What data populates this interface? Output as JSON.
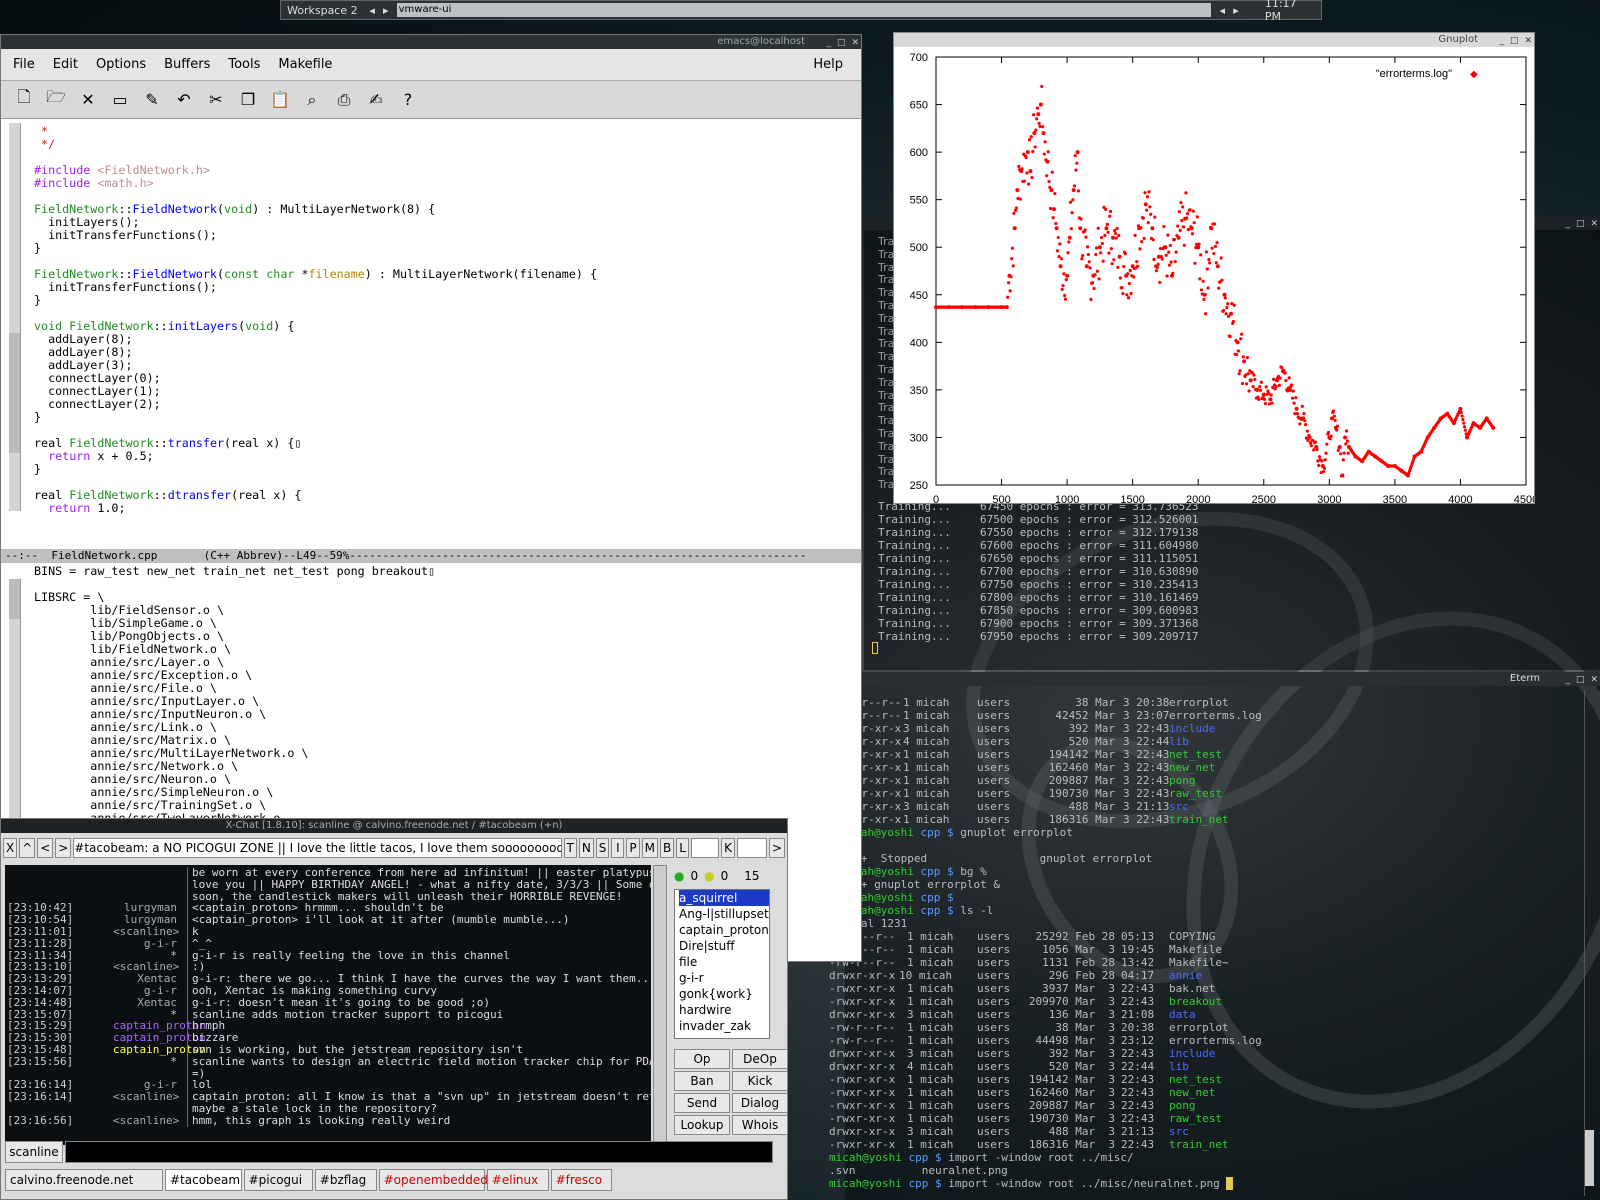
{
  "taskbar": {
    "workspace": "Workspace 2",
    "task": "vmware-ui",
    "clock": "11:17 PM"
  },
  "emacs": {
    "title": "emacs@localhost",
    "menu": [
      "File",
      "Edit",
      "Options",
      "Buffers",
      "Tools",
      "Makefile"
    ],
    "help": "Help",
    "modeline": "--:--  FieldNetwork.cpp       (C++ Abbrev)--L49--59%---------------------------------------------------------------------",
    "lower_first": "BINS = raw_test new_net train_net net_test pong breakout",
    "libsrc": [
      "LIBSRC = \\",
      "        lib/FieldSensor.o \\",
      "        lib/SimpleGame.o \\",
      "        lib/PongObjects.o \\",
      "        lib/FieldNetwork.o \\",
      "        annie/src/Layer.o \\",
      "        annie/src/Exception.o \\",
      "        annie/src/File.o \\",
      "        annie/src/InputLayer.o \\",
      "        annie/src/InputNeuron.o \\",
      "        annie/src/Link.o \\",
      "        annie/src/Matrix.o \\",
      "        annie/src/MultiLayerNetwork.o \\",
      "        annie/src/Network.o \\",
      "        annie/src/Neuron.o \\",
      "        annie/src/SimpleNeuron.o \\",
      "        annie/src/TrainingSet.o \\",
      "        annie/src/TwoLayerNetwork.o"
    ]
  },
  "xchat": {
    "title": "X-Chat [1.8.10]: scanline @ calvino.freenode.net / #tacobeam (+n)",
    "topic": "#tacobeam: a NO PICOGUI ZONE || I love the little tacos, I love them soooooooooo goo",
    "modebtns": [
      "T",
      "N",
      "S",
      "I",
      "P",
      "M",
      "B",
      "L",
      "K"
    ],
    "counts": [
      "0",
      "0",
      "15"
    ],
    "lines": [
      {
        "t": "",
        "n": "",
        "m": "be worn at every conference from here ad infinitum! || easter platypus, we"
      },
      {
        "t": "",
        "n": "",
        "m": "love you || HAPPY BIRTHDAY ANGEL! - what a nifty date, 3/3/3 || Some day"
      },
      {
        "t": "",
        "n": "",
        "m": "soon, the candlestick makers will unleash their HORRIBLE REVENGE!"
      },
      {
        "t": "[23:10:42]",
        "n": "lurgyman",
        "m": "<captain_proton> hrmmm... shouldn't be"
      },
      {
        "t": "[23:10:54]",
        "n": "lurgyman",
        "m": "<captain_proton> i'll look at it after (mumble mumble...)"
      },
      {
        "t": "[23:11:01]",
        "n": "<scanline>",
        "m": "k"
      },
      {
        "t": "[23:11:28]",
        "n": "g-i-r",
        "m": "^_^"
      },
      {
        "t": "[23:11:34]",
        "n": "*",
        "m": "g-i-r is really feeling the love in this channel"
      },
      {
        "t": "[23:13:10]",
        "n": "<scanline>",
        "m": ":)"
      },
      {
        "t": "[23:13:29]",
        "n": "Xentac",
        "m": "g-i-r: there we go... I think I have the curves the way I want them..."
      },
      {
        "t": "[23:14:07]",
        "n": "g-i-r",
        "m": "ooh, Xentac is making something curvy"
      },
      {
        "t": "[23:14:48]",
        "n": "Xentac",
        "m": "g-i-r: doesn't mean it's going to be good ;o)"
      },
      {
        "t": "[23:15:07]",
        "n": "*",
        "m": "scanline adds motion tracker support to picogui"
      },
      {
        "t": "[23:15:29]",
        "n": "captain_proton",
        "m": "hrmph"
      },
      {
        "t": "[23:15:30]",
        "n": "captain_proton",
        "m": "bizzare"
      },
      {
        "t": "[23:15:48]",
        "n": "captain_proton",
        "m": "svn is working, but the jetstream repository isn't"
      },
      {
        "t": "[23:15:56]",
        "n": "*",
        "m": "scanline wants to design an electric field motion tracker chip for PDA use"
      },
      {
        "t": "",
        "n": "",
        "m": "=)"
      },
      {
        "t": "[23:16:14]",
        "n": "g-i-r",
        "m": "lol"
      },
      {
        "t": "[23:16:14]",
        "n": "<scanline>",
        "m": "captain_proton: all I know is that a \"svn up\" in jetstream doesn't return.."
      },
      {
        "t": "",
        "n": "",
        "m": "maybe a stale lock in the repository?"
      },
      {
        "t": "[23:16:56]",
        "n": "<scanline>",
        "m": "hmm, this graph is looking really weird"
      }
    ],
    "nicks": [
      "a_squirrel",
      "Ang-l|stillupset",
      "captain_proton",
      "Dire|stuff",
      "file",
      "g-i-r",
      "gonk{work}",
      "hardwire",
      "invader_zak"
    ],
    "userbtns": [
      "Op",
      "DeOp",
      "Ban",
      "Kick",
      "Send",
      "Dialog",
      "Lookup",
      "Whois"
    ],
    "nick": "scanline",
    "tabs": [
      "calvino.freenode.net",
      "#tacobeam",
      "#picogui",
      "#bzflag",
      "#openembedded",
      "#elinux",
      "#fresco"
    ]
  },
  "gnuplot": {
    "title": "Gnuplot",
    "legend": "\"errorterms.log\""
  },
  "chart_data": {
    "type": "scatter",
    "title": "",
    "legend": "\"errorterms.log\"",
    "color": "#ff0000",
    "xlim": [
      0,
      4500
    ],
    "ylim": [
      250,
      700
    ],
    "xticks": [
      0,
      500,
      1000,
      1500,
      2000,
      2500,
      3000,
      3500,
      4000,
      4500
    ],
    "yticks": [
      250,
      300,
      350,
      400,
      450,
      500,
      550,
      600,
      650,
      700
    ],
    "x": [
      0,
      100,
      200,
      300,
      400,
      500,
      540,
      560,
      600,
      620,
      650,
      700,
      720,
      750,
      780,
      800,
      820,
      850,
      880,
      900,
      920,
      950,
      1000,
      1020,
      1050,
      1080,
      1100,
      1150,
      1200,
      1250,
      1300,
      1350,
      1400,
      1450,
      1500,
      1550,
      1600,
      1650,
      1700,
      1750,
      1800,
      1850,
      1900,
      1950,
      2000,
      2050,
      2100,
      2150,
      2200,
      2250,
      2300,
      2350,
      2400,
      2450,
      2500,
      2550,
      2600,
      2650,
      2700,
      2750,
      2800,
      2850,
      2900,
      2950,
      3000,
      3020,
      3050,
      3080,
      3100,
      3120,
      3150,
      3200,
      3250,
      3300,
      3350,
      3400,
      3450,
      3500,
      3550,
      3600,
      3650,
      3700,
      3750,
      3800,
      3850,
      3900,
      3950,
      4000,
      4050,
      4100,
      4150,
      4200,
      4250
    ],
    "y": [
      437,
      437,
      437,
      437,
      437,
      437,
      437,
      470,
      520,
      560,
      580,
      600,
      580,
      620,
      640,
      650,
      620,
      590,
      560,
      540,
      520,
      480,
      470,
      510,
      560,
      600,
      520,
      480,
      470,
      500,
      520,
      510,
      490,
      470,
      480,
      520,
      545,
      520,
      490,
      500,
      470,
      510,
      530,
      520,
      500,
      450,
      520,
      480,
      450,
      430,
      400,
      380,
      360,
      350,
      345,
      340,
      360,
      370,
      350,
      330,
      320,
      300,
      290,
      270,
      300,
      320,
      310,
      290,
      260,
      300,
      290,
      280,
      275,
      285,
      280,
      275,
      270,
      270,
      265,
      260,
      280,
      285,
      300,
      310,
      320,
      325,
      315,
      330,
      300,
      315,
      310,
      320,
      310
    ]
  },
  "term1": {
    "lines": [
      {
        "a": "Training...",
        "b": "67450 epochs : error = 313.736523"
      },
      {
        "a": "Training...",
        "b": "67500 epochs : error = 312.526001"
      },
      {
        "a": "Training...",
        "b": "67550 epochs : error = 312.179138"
      },
      {
        "a": "Training...",
        "b": "67600 epochs : error = 311.604980"
      },
      {
        "a": "Training...",
        "b": "67650 epochs : error = 311.115051"
      },
      {
        "a": "Training...",
        "b": "67700 epochs : error = 310.630890"
      },
      {
        "a": "Training...",
        "b": "67750 epochs : error = 310.235413"
      },
      {
        "a": "Training...",
        "b": "67800 epochs : error = 310.161469"
      },
      {
        "a": "Training...",
        "b": "67850 epochs : error = 309.600983"
      },
      {
        "a": "Training...",
        "b": "67900 epochs : error = 309.371368"
      },
      {
        "a": "Training...",
        "b": "67950 epochs : error = 309.209717"
      }
    ]
  },
  "eterm": {
    "title": "Eterm",
    "top": [
      [
        "-rw-r--r--",
        "1 micah",
        "users",
        "38 Mar",
        "3 20:38",
        "errorplot",
        ""
      ],
      [
        "-rw-r--r--",
        "1 micah",
        "users",
        "42452 Mar",
        "3 23:07",
        "errorterms.log",
        ""
      ],
      [
        "drwxr-xr-x",
        "3 micah",
        "users",
        "392 Mar",
        "3 22:43",
        "include",
        "bl"
      ],
      [
        "drwxr-xr-x",
        "4 micah",
        "users",
        "520 Mar",
        "3 22:44",
        "lib",
        "bl"
      ],
      [
        "-rwxr-xr-x",
        "1 micah",
        "users",
        "194142 Mar",
        "3 22:43",
        "net_test",
        "g"
      ],
      [
        "-rwxr-xr-x",
        "1 micah",
        "users",
        "162460 Mar",
        "3 22:43",
        "new_net",
        "g"
      ],
      [
        "-rwxr-xr-x",
        "1 micah",
        "users",
        "209887 Mar",
        "3 22:43",
        "pong",
        "g"
      ],
      [
        "-rwxr-xr-x",
        "1 micah",
        "users",
        "190730 Mar",
        "3 22:43",
        "raw_test",
        "g"
      ],
      [
        "drwxr-xr-x",
        "3 micah",
        "users",
        "488 Mar",
        "3 21:13",
        "src",
        "bl"
      ],
      [
        "-rwxr-xr-x",
        "1 micah",
        "users",
        "186316 Mar",
        "3 22:43",
        "train_net",
        "g"
      ]
    ],
    "mid": [
      "micah@yoshi cpp $ gnuplot errorplot",
      "",
      "[1]+  Stopped                 gnuplot errorplot",
      "micah@yoshi cpp $ bg %",
      "[1]+ gnuplot errorplot &",
      "micah@yoshi cpp $",
      "micah@yoshi cpp $ ls -l",
      "total 1231"
    ],
    "bottom": [
      [
        "-rw-r--r--",
        "1 micah",
        "users",
        "25292 Feb 28",
        "05:13",
        "COPYING",
        ""
      ],
      [
        "-rw-r--r--",
        "1 micah",
        "users",
        "1056 Mar  3",
        "19:45",
        "Makefile",
        ""
      ],
      [
        "-rw-r--r--",
        "1 micah",
        "users",
        "1131 Feb 28",
        "13:42",
        "Makefile~",
        ""
      ],
      [
        "drwxr-xr-x",
        "10 micah",
        "users",
        "296 Feb 28",
        "04:17",
        "annie",
        "bl"
      ],
      [
        "-rwxr-xr-x",
        "1 micah",
        "users",
        "3937 Mar  3",
        "22:43",
        "bak.net",
        ""
      ],
      [
        "-rwxr-xr-x",
        "1 micah",
        "users",
        "209970 Mar  3",
        "22:43",
        "breakout",
        "g"
      ],
      [
        "drwxr-xr-x",
        "3 micah",
        "users",
        "136 Mar  3",
        "21:08",
        "data",
        "bl"
      ],
      [
        "-rw-r--r--",
        "1 micah",
        "users",
        "38 Mar  3",
        "20:38",
        "errorplot",
        ""
      ],
      [
        "-rw-r--r--",
        "1 micah",
        "users",
        "44498 Mar  3",
        "23:12",
        "errorterms.log",
        ""
      ],
      [
        "drwxr-xr-x",
        "3 micah",
        "users",
        "392 Mar  3",
        "22:43",
        "include",
        "bl"
      ],
      [
        "drwxr-xr-x",
        "4 micah",
        "users",
        "520 Mar  3",
        "22:44",
        "lib",
        "bl"
      ],
      [
        "-rwxr-xr-x",
        "1 micah",
        "users",
        "194142 Mar  3",
        "22:43",
        "net_test",
        "g"
      ],
      [
        "-rwxr-xr-x",
        "1 micah",
        "users",
        "162460 Mar  3",
        "22:43",
        "new_net",
        "g"
      ],
      [
        "-rwxr-xr-x",
        "1 micah",
        "users",
        "209887 Mar  3",
        "22:43",
        "pong",
        "g"
      ],
      [
        "-rwxr-xr-x",
        "1 micah",
        "users",
        "190730 Mar  3",
        "22:43",
        "raw_test",
        "g"
      ],
      [
        "drwxr-xr-x",
        "3 micah",
        "users",
        "488 Mar  3",
        "21:13",
        "src",
        "bl"
      ],
      [
        "-rwxr-xr-x",
        "1 micah",
        "users",
        "186316 Mar  3",
        "22:43",
        "train_net",
        "g"
      ]
    ],
    "end": [
      "micah@yoshi cpp $ import -window root ../misc/",
      ".svn          neuralnet.png",
      "micah@yoshi cpp $ import -window root ../misc/neuralnet.png"
    ]
  }
}
